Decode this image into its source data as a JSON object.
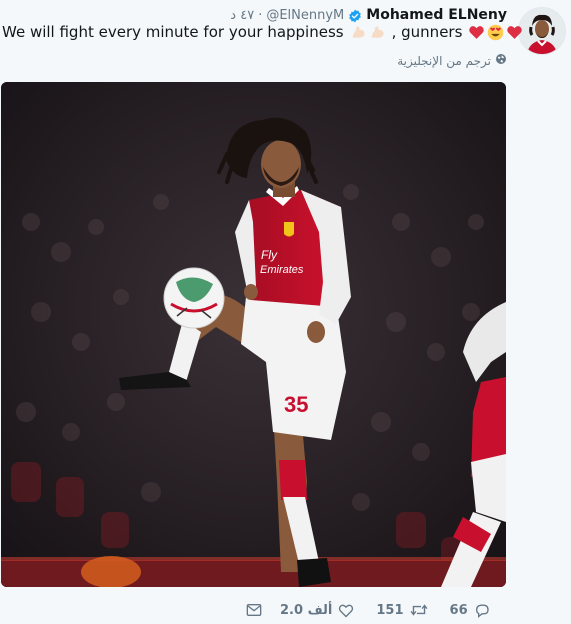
{
  "user": {
    "name": "Mohamed ELNeny",
    "handle": "@ElNennyM",
    "time": "٤٧ د"
  },
  "tweet": {
    "text_main": "We will fight every minute for your happiness",
    "text_end": ", gunners"
  },
  "translate": {
    "label": "ترجم من الإنجليزية"
  },
  "photo": {
    "shirt_sponsor_line1": "Fly",
    "shirt_sponsor_line2": "Emirates",
    "shirt_number": "35"
  },
  "actions": {
    "dm_label": "",
    "likes": "2.0 ألف",
    "retweets": "151",
    "replies": "66"
  },
  "colors": {
    "verified": "#1da1f2",
    "muted": "#657786",
    "heart": "#e0245e",
    "arsenal_red": "#c8102e"
  },
  "icons": [
    "verified-badge-icon",
    "globe-icon",
    "mail-icon",
    "heart-icon",
    "retweet-icon",
    "reply-icon"
  ]
}
